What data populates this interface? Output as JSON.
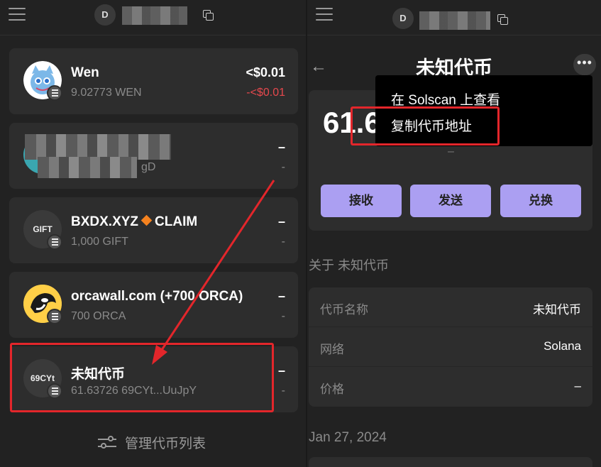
{
  "left": {
    "header": {
      "avatar_letter": "D"
    },
    "tokens": [
      {
        "name": "Wen",
        "amount": "9.02773 WEN",
        "value": "<$0.01",
        "change": "-<$0.01"
      },
      {
        "name": "",
        "amount": "gD",
        "value": "–",
        "change": "-"
      },
      {
        "name_prefix": "BXDX.XYZ",
        "name_suffix": "CLAIM",
        "logo_text": "GIFT",
        "amount": "1,000 GIFT",
        "value": "–",
        "change": "-"
      },
      {
        "name": "orcawall.com (+700 ORCA)",
        "amount": "700 ORCA",
        "value": "–",
        "change": "-"
      },
      {
        "name": "未知代币",
        "logo_text": "69CYt",
        "amount": "61.63726 69CYt...UuJpY",
        "value": "–",
        "change": "-"
      }
    ],
    "manage_label": "管理代币列表"
  },
  "right": {
    "header": {
      "avatar_letter": "D"
    },
    "title": "未知代币",
    "balance": "61.6",
    "balance_sub": "–",
    "actions": [
      "接收",
      "发送",
      "兑换"
    ],
    "about_label": "关于 未知代币",
    "info": [
      {
        "key": "代币名称",
        "value": "未知代币"
      },
      {
        "key": "网络",
        "value": "Solana"
      },
      {
        "key": "价格",
        "value": "–"
      }
    ],
    "date_label": "Jan 27, 2024",
    "menu": {
      "items": [
        "在 Solscan 上查看",
        "复制代币地址"
      ]
    }
  },
  "colors": {
    "accent": "#ab9ff2",
    "negative": "#e5484d",
    "highlight": "#e3262b",
    "background": "#222222",
    "card": "#2d2d2d"
  }
}
